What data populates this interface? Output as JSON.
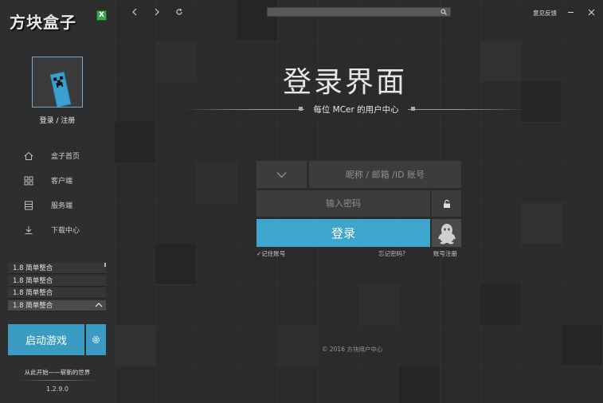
{
  "brand": {
    "logo_text": "方块盒子",
    "badge": "X"
  },
  "sidebar": {
    "login_label": "登录 / 注册",
    "nav": [
      {
        "label": "盒子首页",
        "icon": "home-icon"
      },
      {
        "label": "客户端",
        "icon": "grid-icon"
      },
      {
        "label": "服务端",
        "icon": "server-icon"
      },
      {
        "label": "下载中心",
        "icon": "download-icon"
      }
    ],
    "profiles": [
      "1.8 简单整合",
      "1.8 简单整合",
      "1.8 简单整合",
      "1.8 简单整合"
    ],
    "launch_label": "启动游戏",
    "slogan": "从此开始——崭新的世界",
    "version": "1.2.9.0"
  },
  "header": {
    "search_value": "",
    "feedback_label": "意见反馈"
  },
  "login": {
    "title": "登录界面",
    "subtitle": "每位 MCer 的用户中心",
    "account_placeholder": "昵称 / 邮箱 /ID 账号",
    "password_placeholder": "输入密码",
    "login_label": "登录",
    "remember_label": "记住账号",
    "forgot_label": "忘记密码?",
    "register_label": "账号注册",
    "copyright": "© 2016    方块用户中心"
  },
  "colors": {
    "accent": "#3ea5cc",
    "sidebar_bg": "#2e2e2e",
    "main_bg": "#2b2b2b"
  }
}
